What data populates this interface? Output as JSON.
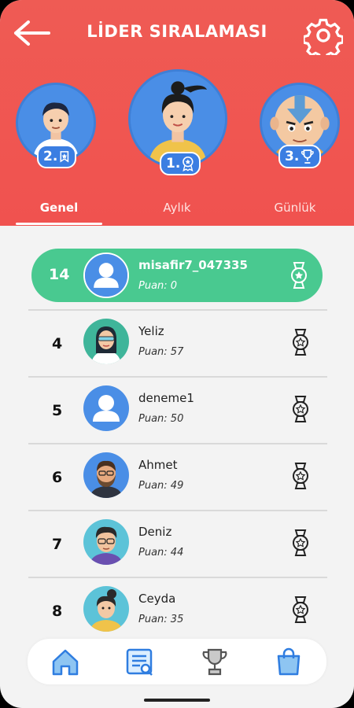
{
  "header": {
    "title": "LİDER SIRALAMASI",
    "back_icon": "arrow-left-icon",
    "settings_icon": "gear-icon",
    "bg_color": "#ef5b54"
  },
  "podium": {
    "first": {
      "rank_label": "1.",
      "avatar": "woman-ponytail-avatar"
    },
    "second": {
      "rank_label": "2.",
      "avatar": "boy-avatar"
    },
    "third": {
      "rank_label": "3.",
      "avatar": "bald-monk-avatar"
    }
  },
  "tabs": [
    {
      "label": "Genel",
      "active": true
    },
    {
      "label": "Aylık",
      "active": false
    },
    {
      "label": "Günlük",
      "active": false
    }
  ],
  "current_user": {
    "rank": "14",
    "name": "misafir7_047335",
    "score": "Puan: 0",
    "highlight_color": "#49c990"
  },
  "leaderboard": [
    {
      "rank": "4",
      "name": "Yeliz",
      "score": "Puan: 57",
      "avatar": "woman-glasses-avatar"
    },
    {
      "rank": "5",
      "name": "deneme1",
      "score": "Puan: 50",
      "avatar": "default-user-avatar"
    },
    {
      "rank": "6",
      "name": "Ahmet",
      "score": "Puan: 49",
      "avatar": "bearded-man-avatar"
    },
    {
      "rank": "7",
      "name": "Deniz",
      "score": "Puan: 44",
      "avatar": "man-glasses-avatar"
    },
    {
      "rank": "8",
      "name": "Ceyda",
      "score": "Puan: 35",
      "avatar": "woman-bun-avatar"
    }
  ],
  "bottom_nav": [
    {
      "icon": "home-icon"
    },
    {
      "icon": "quiz-list-icon"
    },
    {
      "icon": "trophy-icon"
    },
    {
      "icon": "shopping-bag-icon"
    }
  ],
  "accent_color": "#3b7ee2"
}
